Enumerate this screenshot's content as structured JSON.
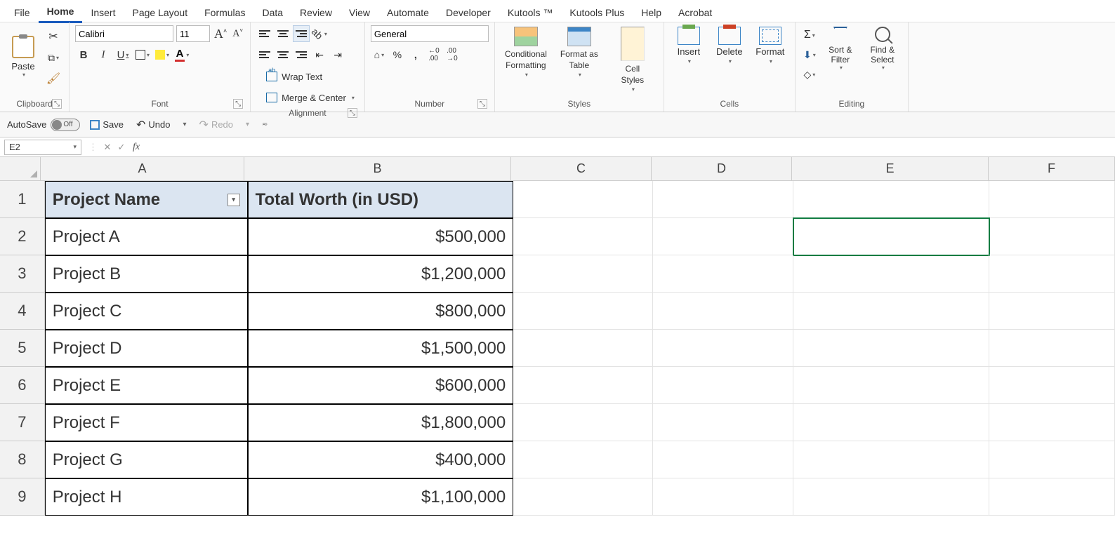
{
  "tabs": [
    "File",
    "Home",
    "Insert",
    "Page Layout",
    "Formulas",
    "Data",
    "Review",
    "View",
    "Automate",
    "Developer",
    "Kutools ™",
    "Kutools Plus",
    "Help",
    "Acrobat"
  ],
  "active_tab": "Home",
  "ribbon": {
    "clipboard": {
      "label": "Clipboard",
      "paste": "Paste"
    },
    "font": {
      "label": "Font",
      "name": "Calibri",
      "size": "11"
    },
    "alignment": {
      "label": "Alignment",
      "wrap": "Wrap Text",
      "merge": "Merge & Center"
    },
    "number": {
      "label": "Number",
      "format": "General"
    },
    "styles": {
      "label": "Styles",
      "cond1": "Conditional",
      "cond2": "Formatting",
      "tbl1": "Format as",
      "tbl2": "Table",
      "cell1": "Cell",
      "cell2": "Styles"
    },
    "cells": {
      "label": "Cells",
      "insert": "Insert",
      "delete": "Delete",
      "format": "Format"
    },
    "editing": {
      "label": "Editing",
      "sort1": "Sort &",
      "sort2": "Filter",
      "find1": "Find &",
      "find2": "Select"
    }
  },
  "qat": {
    "autosave": "AutoSave",
    "toggle": "Off",
    "save": "Save",
    "undo": "Undo",
    "redo": "Redo"
  },
  "namebox": "E2",
  "columns": [
    "A",
    "B",
    "C",
    "D",
    "E",
    "F"
  ],
  "col_widths": [
    "colA",
    "colB",
    "colC",
    "colD",
    "colE",
    "colF"
  ],
  "headers": {
    "A": "Project Name",
    "B": "Total Worth (in USD)"
  },
  "rows": [
    {
      "n": "1",
      "A": "Project Name",
      "B": "Total Worth (in USD)",
      "header": true
    },
    {
      "n": "2",
      "A": "Project A",
      "B": "$500,000"
    },
    {
      "n": "3",
      "A": "Project B",
      "B": "$1,200,000"
    },
    {
      "n": "4",
      "A": "Project C",
      "B": "$800,000"
    },
    {
      "n": "5",
      "A": "Project D",
      "B": "$1,500,000"
    },
    {
      "n": "6",
      "A": "Project E",
      "B": "$600,000"
    },
    {
      "n": "7",
      "A": "Project F",
      "B": "$1,800,000"
    },
    {
      "n": "8",
      "A": "Project G",
      "B": "$400,000"
    },
    {
      "n": "9",
      "A": "Project H",
      "B": "$1,100,000"
    }
  ],
  "selected_cell": "E2"
}
